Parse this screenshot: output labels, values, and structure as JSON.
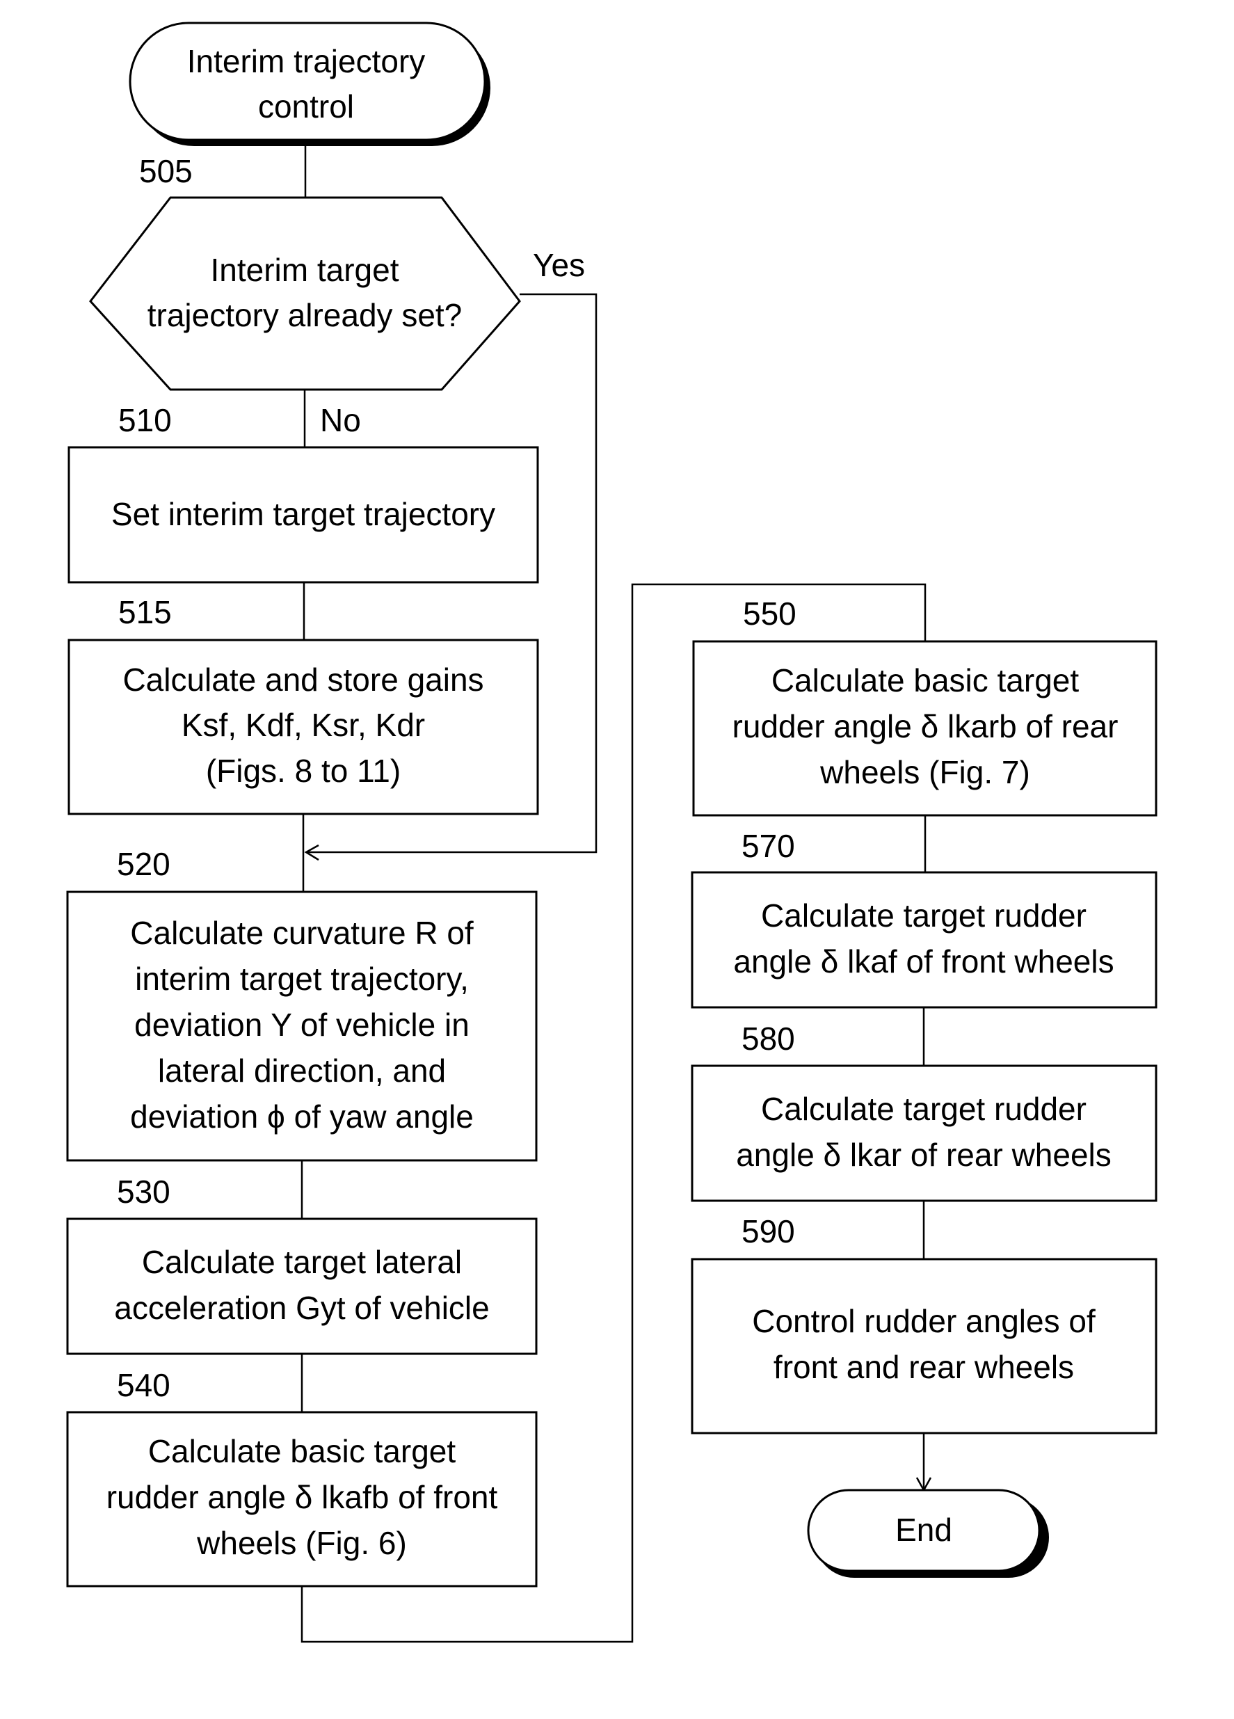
{
  "flowchart": {
    "start": {
      "lines": [
        "Interim trajectory",
        "control"
      ]
    },
    "decision": {
      "id": "505",
      "lines": [
        "Interim target",
        "trajectory already set?"
      ],
      "yes_label": "Yes",
      "no_label": "No"
    },
    "steps": [
      {
        "id": "510",
        "lines": [
          "Set interim target trajectory"
        ]
      },
      {
        "id": "515",
        "lines": [
          "Calculate and store gains",
          "Ksf, Kdf, Ksr, Kdr",
          "(Figs. 8 to 11)"
        ]
      },
      {
        "id": "520",
        "lines": [
          "Calculate curvature R of",
          "interim target trajectory,",
          "deviation Y of vehicle in",
          "lateral direction, and",
          "deviation ϕ  of yaw angle"
        ]
      },
      {
        "id": "530",
        "lines": [
          "Calculate target lateral",
          "acceleration Gyt of vehicle"
        ]
      },
      {
        "id": "540",
        "lines": [
          "Calculate basic target",
          "rudder angle  δ lkafb of front",
          "wheels (Fig. 6)"
        ]
      },
      {
        "id": "550",
        "lines": [
          "Calculate basic target",
          "rudder angle  δ lkarb of rear",
          "wheels (Fig. 7)"
        ]
      },
      {
        "id": "570",
        "lines": [
          "Calculate target rudder",
          "angle  δ lkaf of front wheels"
        ]
      },
      {
        "id": "580",
        "lines": [
          "Calculate target rudder",
          "angle  δ lkar of rear wheels"
        ]
      },
      {
        "id": "590",
        "lines": [
          "Control rudder angles of",
          "front and rear wheels"
        ]
      }
    ],
    "end": {
      "lines": [
        "End"
      ]
    }
  }
}
